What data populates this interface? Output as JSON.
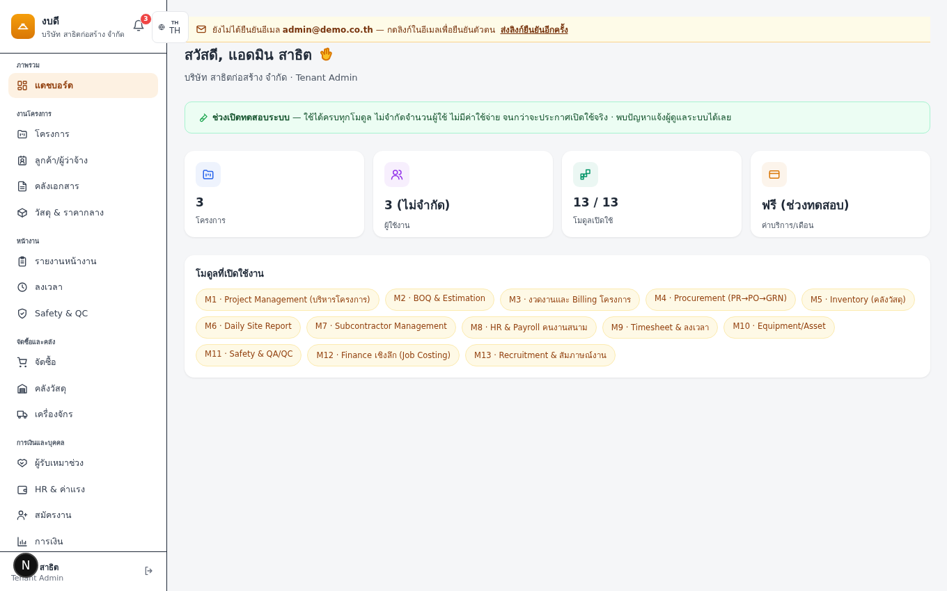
{
  "sidebar": {
    "brand": {
      "name": "งบดี",
      "company": "บริษัท สาธิตก่อสร้าง จำกัด"
    },
    "notifications": {
      "count": "3"
    },
    "language": {
      "small": "TH",
      "code": "TH"
    },
    "sections": [
      {
        "title": "ภาพรวม",
        "items": [
          {
            "label": "แดชบอร์ด",
            "selected": true
          }
        ]
      },
      {
        "title": "งานโครงการ",
        "items": [
          {
            "label": "โครงการ",
            "selected": false
          },
          {
            "label": "ลูกค้า/ผู้ว่าจ้าง",
            "selected": false
          },
          {
            "label": "คลังเอกสาร",
            "selected": false
          },
          {
            "label": "วัสดุ & ราคากลาง",
            "selected": false
          }
        ]
      },
      {
        "title": "หน้างาน",
        "items": [
          {
            "label": "รายงานหน้างาน",
            "selected": false
          },
          {
            "label": "ลงเวลา",
            "selected": false
          },
          {
            "label": "Safety & QC",
            "selected": false
          }
        ]
      },
      {
        "title": "จัดซื้อและคลัง",
        "items": [
          {
            "label": "จัดซื้อ",
            "selected": false
          },
          {
            "label": "คลังวัสดุ",
            "selected": false
          },
          {
            "label": "เครื่องจักร",
            "selected": false
          }
        ]
      },
      {
        "title": "การเงินและบุคคล",
        "items": [
          {
            "label": "ผู้รับเหมาช่วง",
            "selected": false
          },
          {
            "label": "HR & ค่าแรง",
            "selected": false
          },
          {
            "label": "สมัครงาน",
            "selected": false
          },
          {
            "label": "การเงิน",
            "selected": false
          }
        ]
      }
    ],
    "user": {
      "name": "สาธิต",
      "role": "Tenant Admin"
    },
    "dev_badge": "N"
  },
  "banner": {
    "text": "ยังไม่ได้ยืนยันอีเมล **admin@demo.co.th** — กดลิงก์ในอีเมลเพื่อยืนยันตัวตน",
    "link": "ส่งลิงก์ยืนยันอีกครั้ง"
  },
  "greeting": {
    "title": "สวัสดี, แอดมิน สาธิต",
    "subtitle": "บริษัท สาธิตก่อสร้าง จำกัด · Tenant Admin"
  },
  "notice": "**ช่วงเปิดทดสอบระบบ** — ใช้ได้ครบทุกโมดูล ไม่จำกัดจำนวนผู้ใช้ ไม่มีค่าใช้จ่าย จนกว่าจะประกาศเปิดใช้จริง · พบปัญหาแจ้งผู้ดูแลระบบได้เลย",
  "stats": [
    {
      "value": "3",
      "label": "โครงการ",
      "color": "#2563eb"
    },
    {
      "value": "3 (ไม่จำกัด)",
      "label": "ผู้ใช้งาน",
      "color": "#9333ea"
    },
    {
      "value": "13 / 13",
      "label": "โมดูลเปิดใช้",
      "color": "#059669"
    },
    {
      "value": "ฟรี (ช่วงทดสอบ)",
      "label": "ค่าบริการ/เดือน",
      "color": "#d97706"
    }
  ],
  "modules": {
    "title": "โมดูลที่เปิดใช้งาน",
    "items": [
      "M1 · Project Management (บริหารโครงการ)",
      "M2 · BOQ & Estimation",
      "M3 · งวดงานและ Billing โครงการ",
      "M4 · Procurement (PR→PO→GRN)",
      "M5 · Inventory (คลังวัสดุ)",
      "M6 · Daily Site Report",
      "M7 · Subcontractor Management",
      "M8 · HR & Payroll คนงานสนาม",
      "M9 · Timesheet & ลงเวลา",
      "M10 · Equipment/Asset",
      "M11 · Safety & QA/QC",
      "M12 · Finance เชิงลึก (Job Costing)",
      "M13 · Recruitment & สัมภาษณ์งาน"
    ]
  }
}
